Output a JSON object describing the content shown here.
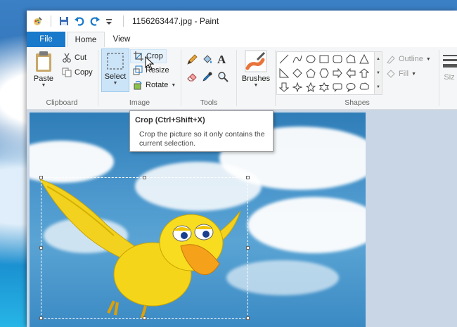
{
  "window": {
    "title": "1156263447.jpg - Paint"
  },
  "tabs": [
    {
      "label": "File"
    },
    {
      "label": "Home"
    },
    {
      "label": "View"
    }
  ],
  "clipboard": {
    "paste_label": "Paste",
    "cut_label": "Cut",
    "copy_label": "Copy",
    "group_label": "Clipboard"
  },
  "image": {
    "select_label": "Select",
    "crop_label": "Crop",
    "resize_label": "Resize",
    "rotate_label": "Rotate",
    "group_label": "Image"
  },
  "tools": {
    "group_label": "Tools"
  },
  "brushes": {
    "label": "Brushes"
  },
  "shapes": {
    "outline_label": "Outline",
    "fill_label": "Fill",
    "group_label": "Shapes"
  },
  "size": {
    "label": "Siz"
  },
  "tooltip": {
    "title": "Crop (Ctrl+Shift+X)",
    "body": "Crop the picture so it only contains the current selection."
  },
  "colors": {
    "accent": "#1979ca",
    "selection_bg": "#cce4f7",
    "ribbon_bg": "#f5f6f7"
  }
}
